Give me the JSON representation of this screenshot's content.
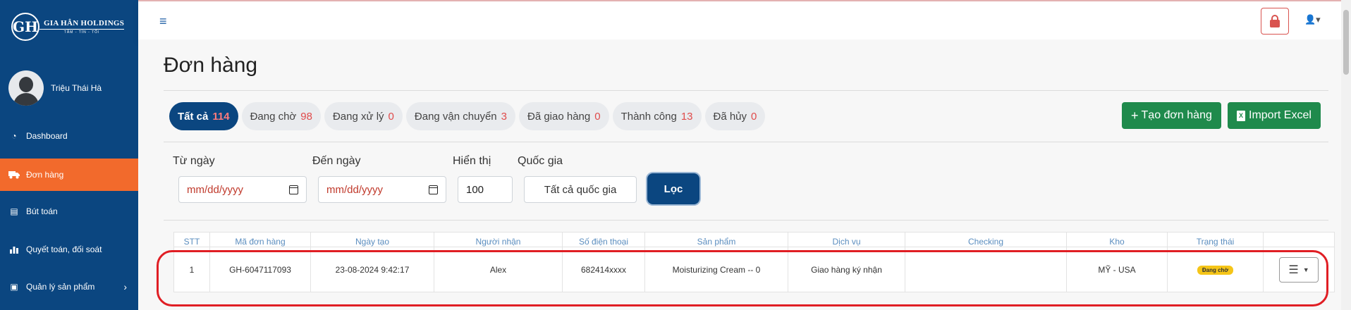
{
  "brand": {
    "logo_letters": "GH",
    "name": "GIA HÂN HOLDINGS",
    "tagline": "TÂM - TÍN - TỐI"
  },
  "user": {
    "name": "Triệu Thái Hà"
  },
  "sidebar": {
    "items": [
      {
        "label": "Dashboard",
        "icon": "dashboard-icon",
        "glyph": "◔"
      },
      {
        "label": "Đơn hàng",
        "icon": "truck-icon",
        "glyph": "🚚",
        "active": true
      },
      {
        "label": "Bút toán",
        "icon": "book-icon",
        "glyph": "▤"
      },
      {
        "label": "Quyết toán, đối soát",
        "icon": "bar-chart-icon",
        "glyph": "▮"
      },
      {
        "label": "Quản lý sản phẩm",
        "icon": "box-icon",
        "glyph": "▣",
        "chevron": "›"
      }
    ]
  },
  "topbar": {
    "menu_glyph": "≡",
    "user_glyph": "👤▾"
  },
  "page": {
    "title": "Đơn hàng"
  },
  "tabs": [
    {
      "label": "Tất cả",
      "count": "114",
      "active": true
    },
    {
      "label": "Đang chờ",
      "count": "98"
    },
    {
      "label": "Đang xử lý",
      "count": "0"
    },
    {
      "label": "Đang vận chuyển",
      "count": "3"
    },
    {
      "label": "Đã giao hàng",
      "count": "0"
    },
    {
      "label": "Thành công",
      "count": "13"
    },
    {
      "label": "Đã hủy",
      "count": "0"
    }
  ],
  "actions": {
    "create_label": "Tạo đơn hàng",
    "import_label": "Import Excel"
  },
  "filters": {
    "from_label": "Từ ngày",
    "from_value": "mm/dd/yyyy",
    "to_label": "Đến ngày",
    "to_value": "mm/dd/yyyy",
    "show_label": "Hiển thị",
    "show_value": "100",
    "country_label": "Quốc gia",
    "country_value": "Tất cả quốc gia",
    "filter_button": "Lọc"
  },
  "table": {
    "headers": [
      "STT",
      "Mã đơn hàng",
      "Ngày tạo",
      "Người nhận",
      "Số điện thoại",
      "Sản phẩm",
      "Dịch vụ",
      "Checking",
      "Kho",
      "Trạng thái",
      ""
    ],
    "rows": [
      {
        "stt": "1",
        "code": "GH-6047117093",
        "created": "23-08-2024 9:42:17",
        "recipient": "Alex",
        "phone": "682414xxxx",
        "product": "Moisturizing Cream -- 0",
        "service": "Giao hàng ký nhận",
        "checking": "",
        "warehouse": "MỸ - USA",
        "status": "Đang chờ"
      }
    ]
  },
  "colors": {
    "sidebar": "#0b4680",
    "active_nav": "#f26a2c",
    "green": "#1f8a4c",
    "count_red": "#e04b4b",
    "badge": "#f5c518",
    "highlight": "#e01e24"
  }
}
